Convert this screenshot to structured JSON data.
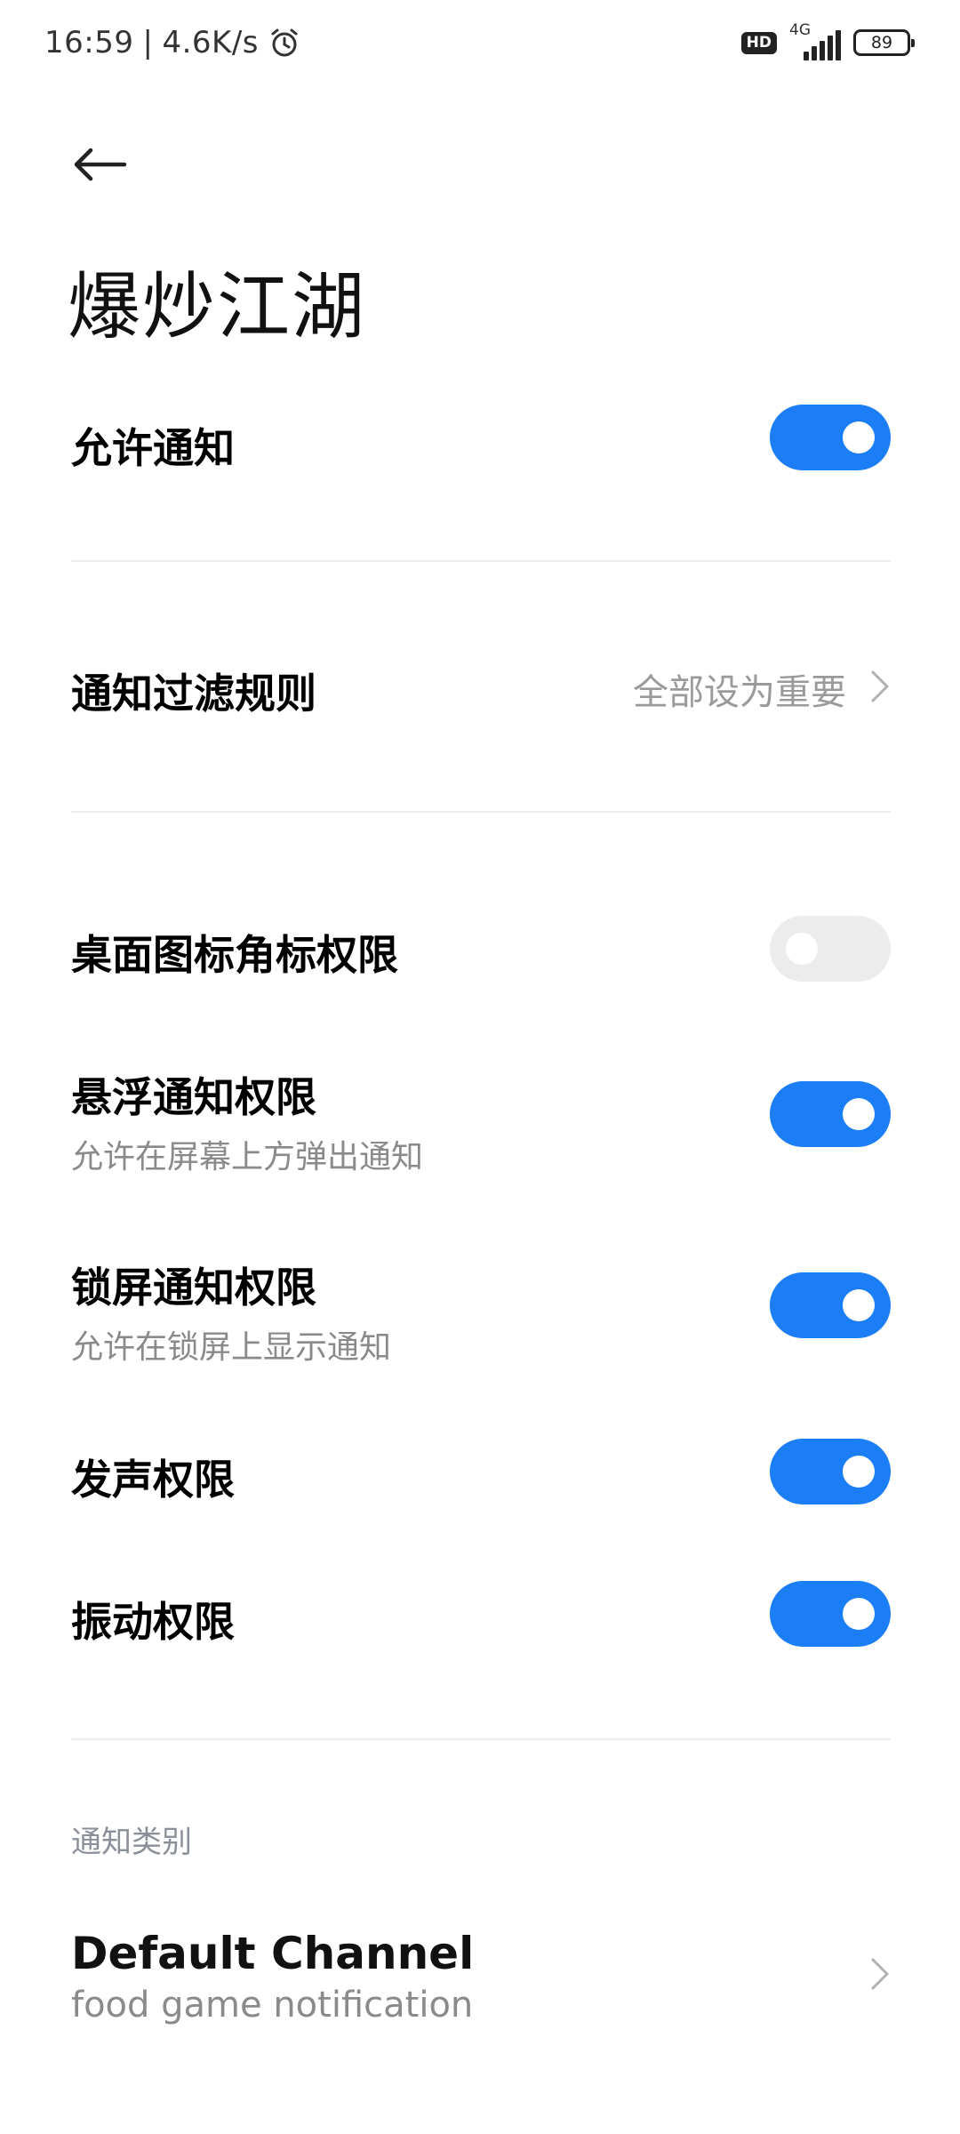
{
  "status_bar": {
    "time": "16:59",
    "separator": "|",
    "speed": "4.6K/s",
    "hd": "HD",
    "network": "4G",
    "battery": "89"
  },
  "header": {
    "title": "爆炒江湖"
  },
  "settings": {
    "allow_notifications": {
      "label": "允许通知",
      "on": true
    },
    "filter_rule": {
      "label": "通知过滤规则",
      "value": "全部设为重要"
    },
    "badge_permission": {
      "label": "桌面图标角标权限",
      "on": false
    },
    "floating_permission": {
      "label": "悬浮通知权限",
      "sub": "允许在屏幕上方弹出通知",
      "on": true
    },
    "lockscreen_permission": {
      "label": "锁屏通知权限",
      "sub": "允许在锁屏上显示通知",
      "on": true
    },
    "sound_permission": {
      "label": "发声权限",
      "on": true
    },
    "vibration_permission": {
      "label": "振动权限",
      "on": true
    }
  },
  "categories": {
    "header": "通知类别",
    "items": [
      {
        "title": "Default Channel",
        "sub": "food game notification"
      }
    ]
  },
  "colors": {
    "accent": "#1c7ef7",
    "toggle_off": "#ececec"
  }
}
